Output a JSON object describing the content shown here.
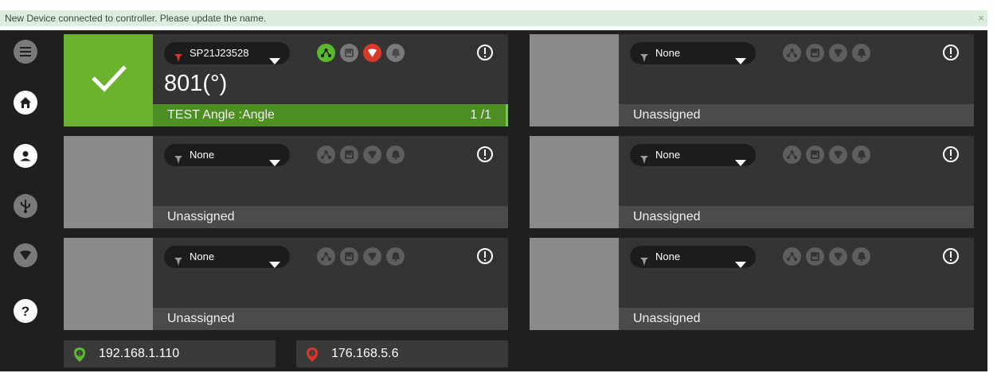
{
  "banner": {
    "message": "New Device connected to controller. Please update the name.",
    "close_glyph": "×"
  },
  "colors": {
    "accent_green": "#6bb22e",
    "alert_red": "#d9382a",
    "panel_bg": "#343434",
    "app_bg": "#1f1f1f"
  },
  "sidebar": {
    "items": [
      {
        "name": "menu-icon"
      },
      {
        "name": "home-icon"
      },
      {
        "name": "user-icon"
      },
      {
        "name": "usb-icon"
      },
      {
        "name": "shield-icon"
      },
      {
        "name": "help-icon"
      }
    ]
  },
  "panels": [
    {
      "device": "SP21J23528",
      "value": "801(°)",
      "footer": "TEST Angle :Angle",
      "count": "1 /1",
      "state": "active"
    },
    {
      "device": "None",
      "footer": "Unassigned"
    },
    {
      "device": "None",
      "footer": "Unassigned"
    },
    {
      "device": "None",
      "footer": "Unassigned"
    },
    {
      "device": "None",
      "footer": "Unassigned"
    },
    {
      "device": "None",
      "footer": "Unassigned"
    }
  ],
  "network": [
    {
      "ip": "192.168.1.110",
      "index": "1",
      "status_color": "#5cb82e"
    },
    {
      "ip": "176.168.5.6",
      "index": "2",
      "status_color": "#d9382a"
    }
  ]
}
